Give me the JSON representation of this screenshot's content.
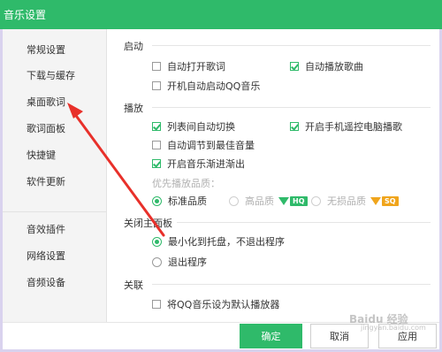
{
  "window": {
    "title": "音乐设置"
  },
  "sidebar": {
    "items": [
      {
        "label": "常规设置"
      },
      {
        "label": "下载与缓存"
      },
      {
        "label": "桌面歌词"
      },
      {
        "label": "歌词面板"
      },
      {
        "label": "快捷键"
      },
      {
        "label": "软件更新"
      },
      {
        "label": "音效插件"
      },
      {
        "label": "网络设置"
      },
      {
        "label": "音频设备"
      }
    ],
    "selected": "常规设置"
  },
  "startup": {
    "title": "启动",
    "auto_open_lyrics": {
      "label": "自动打开歌词",
      "checked": false
    },
    "auto_play": {
      "label": "自动播放歌曲",
      "checked": true
    },
    "boot_start": {
      "label": "开机自动启动QQ音乐",
      "checked": false
    }
  },
  "playback": {
    "title": "播放",
    "list_auto_switch": {
      "label": "列表间自动切换",
      "checked": true
    },
    "phone_remote": {
      "label": "开启手机遥控电脑播歌",
      "checked": true
    },
    "auto_volume": {
      "label": "自动调节到最佳音量",
      "checked": false
    },
    "fade": {
      "label": "开启音乐渐进渐出",
      "checked": true
    },
    "quality_label": "优先播放品质：",
    "quality_options": [
      {
        "label": "标准品质",
        "selected": true,
        "enabled": true
      },
      {
        "label": "高品质",
        "selected": false,
        "enabled": false,
        "badge": "HQ"
      },
      {
        "label": "无损品质",
        "selected": false,
        "enabled": false,
        "badge": "SQ"
      }
    ]
  },
  "close_panel": {
    "title": "关闭主面板",
    "minimize": {
      "label": "最小化到托盘，不退出程序",
      "selected": true
    },
    "exit": {
      "label": "退出程序",
      "selected": false
    }
  },
  "association": {
    "title": "关联",
    "default_player": {
      "label": "将QQ音乐设为默认播放器",
      "checked": false
    }
  },
  "buttons": {
    "ok": "确定",
    "cancel": "取消",
    "apply": "应用"
  },
  "colors": {
    "accent": "#2fba6a",
    "arrow": "#e8302a",
    "hq_badge": "#2fba6a",
    "sq_badge": "#f0a51c"
  },
  "watermark": {
    "text": "Baidu 经验",
    "sub": "jingyan.baidu.com"
  }
}
